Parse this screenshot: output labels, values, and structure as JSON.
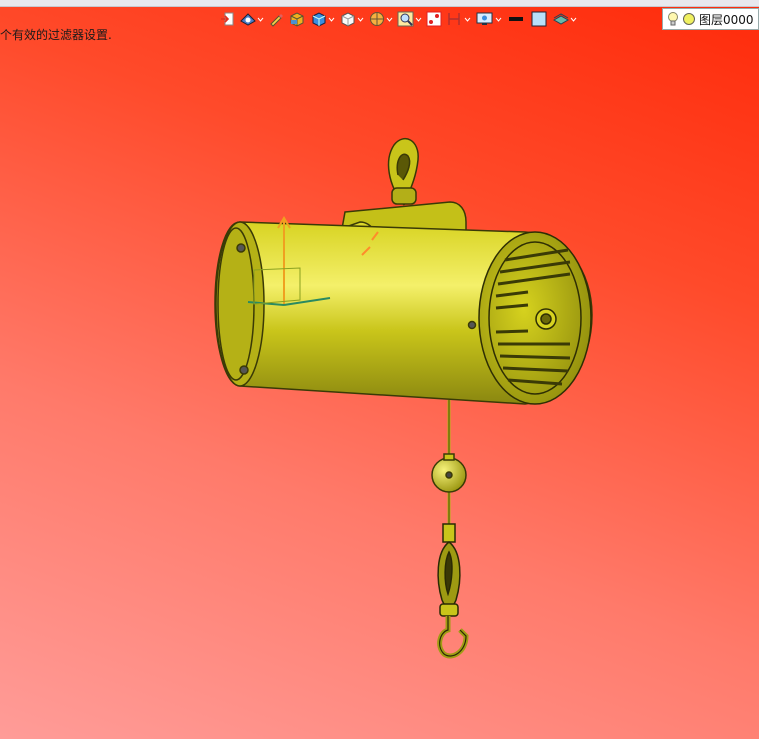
{
  "status": {
    "message": "个有效的过滤器设置."
  },
  "toolbar": {
    "items": [
      {
        "icon": "exit-icon"
      },
      {
        "icon": "view-fly-icon"
      },
      {
        "icon": "pencil-icon"
      },
      {
        "icon": "shading-box-icon"
      },
      {
        "icon": "cube-blue-icon"
      },
      {
        "icon": "cube-white-icon"
      },
      {
        "icon": "cut-plane-icon"
      },
      {
        "icon": "zoom-icon"
      },
      {
        "icon": "measure-icon"
      },
      {
        "icon": "section-icon"
      },
      {
        "icon": "display-icon"
      },
      {
        "icon": "line-thickness-icon"
      },
      {
        "icon": "color-swatch-icon"
      },
      {
        "icon": "layer-filter-icon"
      }
    ],
    "accent": "#1e6fd0"
  },
  "layer": {
    "label": "图层0000"
  },
  "colors": {
    "model": "#c9c51a",
    "model_dark": "#6b6a0a",
    "model_light": "#f2ee6a"
  }
}
